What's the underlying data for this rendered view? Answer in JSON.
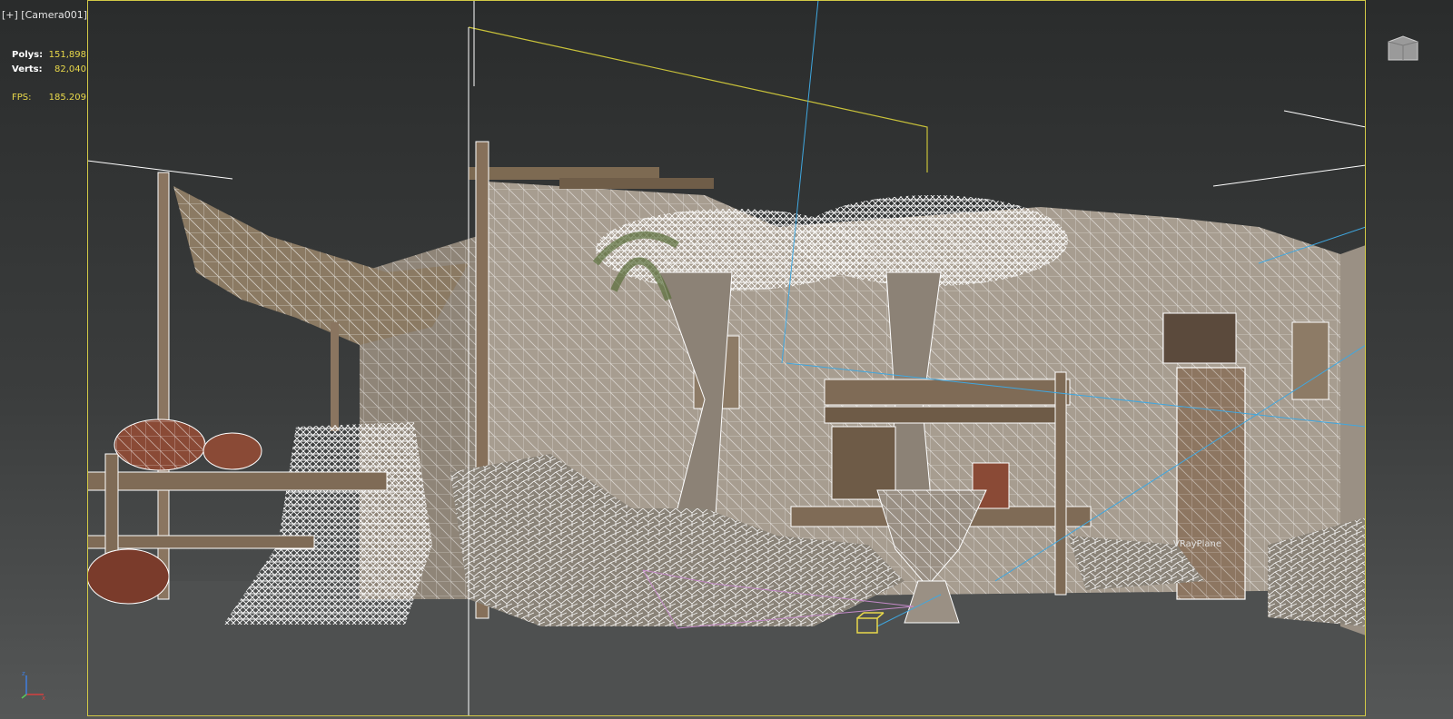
{
  "viewport": {
    "label": "[+] [Camera001]",
    "stats": {
      "polys_label": "Polys:",
      "polys_value": "151,898",
      "verts_label": "Verts:",
      "verts_value": "82,040",
      "fps_label": "FPS:",
      "fps_value": "185.209"
    },
    "scene_object_label": "VRayPlane",
    "frame_color": "#d2c946",
    "stats_value_color": "#e8d84a"
  },
  "icons": {
    "view_cube": "view-cube-icon",
    "axis_tripod": "axis-tripod-icon"
  }
}
